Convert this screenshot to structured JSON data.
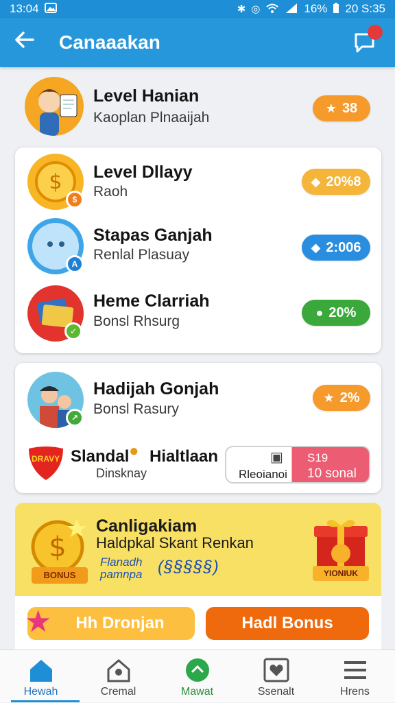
{
  "status_bar": {
    "time": "13:04",
    "battery_text": "16%",
    "right_time": "20 S:35"
  },
  "header": {
    "title": "Canaaakan"
  },
  "top_row": {
    "title": "Level Hanian",
    "subtitle": "Kaoplan Plnaaijah",
    "pill": "38"
  },
  "card1": {
    "items": [
      {
        "title": "Level Dllayy",
        "subtitle": "Raoh",
        "pill": "20%8"
      },
      {
        "title": "Stapas Ganjah",
        "subtitle": "Renlal Plasuay",
        "pill": "2:006"
      },
      {
        "title": "Heme Clarriah",
        "subtitle": "Bonsl Rhsurg",
        "pill": "20%"
      }
    ]
  },
  "card2": {
    "item": {
      "title": "Hadijah Gonjah",
      "subtitle": "Bonsl Rasury",
      "pill": "2%"
    },
    "deal": {
      "badge": "DRAVY",
      "title": "Slandal",
      "title2": "Hialtlaan",
      "subtitle": "Dinsknay"
    },
    "offer": {
      "left_label": "Rleoianoi",
      "price": "S19",
      "detail": "10 sonal"
    }
  },
  "promo": {
    "title": "Canligakiam",
    "subtitle": "Haldpkal Skant Renkan",
    "note_line1": "Flanadh",
    "note_line2": "pamnpa",
    "code": "(§§§§§)",
    "coin_label": "BONUS",
    "gift_label": "YIONIUK"
  },
  "cta": {
    "left": "Hh Dronjan",
    "right": "Hadl Bonus"
  },
  "nav": {
    "items": [
      {
        "label": "Hewah"
      },
      {
        "label": "Cremal"
      },
      {
        "label": "Mawat"
      },
      {
        "label": "Ssenalt"
      },
      {
        "label": "Hrens"
      }
    ]
  },
  "colors": {
    "app_bar": "#2797dc",
    "pill_orange": "#f59a2b",
    "pill_blue": "#2a8ee0",
    "pill_green": "#3aa83a",
    "promo_yellow": "#f7e064",
    "cta_right": "#ee6a0c"
  }
}
